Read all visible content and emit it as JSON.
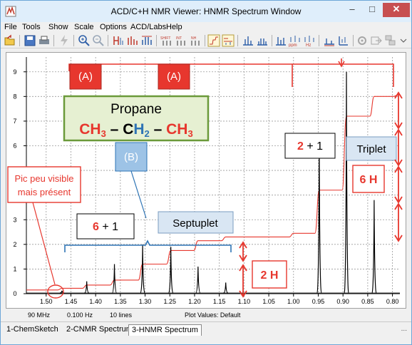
{
  "window": {
    "title": "ACD/C+H NMR Viewer: HNMR Spectrum Window",
    "minimize_glyph": "–",
    "maximize_glyph": "□",
    "close_glyph": "✕"
  },
  "menu": [
    "File",
    "Tools",
    "Show",
    "Scale",
    "Options",
    "ACD/Labs",
    "Help"
  ],
  "toolbar": {
    "icons": [
      "open-file-icon",
      "save-icon",
      "print-icon",
      "lightning-icon",
      "zoom-in-icon",
      "zoom-out-icon",
      "peak-pick-icon",
      "peak-list-icon",
      "multiplet-icon",
      "shift-label-icon",
      "integral-label-icon",
      "multiplicity-label-icon",
      "integration-toggle-icon",
      "spectrum-view-icon",
      "peaks-icon",
      "multiplet-view-icon",
      "simulate-icon",
      "ppm-icon",
      "hz-icon",
      "baseline-icon",
      "lock-icon",
      "settings-icon",
      "export-icon",
      "arrange-icon",
      "menu-more-icon"
    ],
    "ppm_label": "ppm",
    "hz_label": "Hz",
    "shift_label": "SHIFT",
    "int_label": "INT",
    "nh_label": "NH"
  },
  "status": {
    "frequency": "90 MHz",
    "step": "0.100 Hz",
    "lines": "10 lines",
    "plot_values": "Plot Values: Default"
  },
  "tabs": [
    "1-ChemSketch",
    "2-CNMR Spectrum",
    "3-HNMR Spectrum"
  ],
  "tab_more": "...",
  "annotations": {
    "label_a1": "(A)",
    "label_a2": "(A)",
    "label_b": "(B)",
    "molecule_name": "Propane",
    "formula": {
      "ch3_left": "CH",
      "ch3_left_sub": "3",
      "dash1": " – ",
      "c_mid": "C",
      "h_mid": "H",
      "h_mid_sub": "2",
      "dash2": " – ",
      "ch3_right": "CH",
      "ch3_right_sub": "3"
    },
    "pic_note_line1": "Pic peu visible",
    "pic_note_line2": "mais présent",
    "sept_count_red": "6",
    "sept_count_rest": " + 1",
    "septuplet": "Septuplet",
    "trip_count_red": "2",
    "trip_count_rest": " + 1",
    "triplet": "Triplet",
    "h6": "6 H",
    "h2": "2 H",
    "colors": {
      "red": "#e7372e",
      "green_border": "#6b9a3a",
      "green_fill": "#e6f0d2",
      "blue_label": "#2e74b5",
      "triplet_fill": "#d9e6f3"
    }
  },
  "chart_data": {
    "type": "line",
    "xlabel": "",
    "ylabel": "",
    "xlim": [
      1.54,
      0.785
    ],
    "ylim": [
      0,
      9.6
    ],
    "x_ticks": [
      1.5,
      1.45,
      1.4,
      1.35,
      1.3,
      1.25,
      1.2,
      1.15,
      1.1,
      1.05,
      1.0,
      0.95,
      0.9,
      0.85,
      0.8
    ],
    "x_tick_labels": [
      "1.50",
      "1.45",
      "1.40",
      "1.35",
      "1.30",
      "1.25",
      "1.20",
      "1.15",
      "1.10",
      "1.05",
      "1.00",
      "0.95",
      "0.90",
      "0.85",
      "0.80"
    ],
    "y_ticks": [
      0,
      1,
      2,
      3,
      4,
      5,
      6,
      7,
      8,
      9
    ],
    "y_tick_labels": [
      "0",
      "1",
      "2",
      "3",
      "4",
      "5",
      "6",
      "7",
      "8",
      "9"
    ],
    "grid": true,
    "series": [
      {
        "name": "",
        "kind": "spectrum",
        "color": "#000000",
        "peaks": [
          {
            "x": 1.468,
            "y": 0.12
          },
          {
            "x": 1.418,
            "y": 0.5
          },
          {
            "x": 1.362,
            "y": 1.2
          },
          {
            "x": 1.305,
            "y": 2.0
          },
          {
            "x": 1.248,
            "y": 1.9
          },
          {
            "x": 1.193,
            "y": 1.1
          },
          {
            "x": 1.137,
            "y": 0.45
          },
          {
            "x": 0.948,
            "y": 6.5
          },
          {
            "x": 0.893,
            "y": 9.0
          },
          {
            "x": 0.837,
            "y": 3.8
          }
        ]
      },
      {
        "name": "",
        "kind": "integral",
        "color": "#e7372e",
        "steps": [
          {
            "x": 1.54,
            "y": 0.15
          },
          {
            "x": 1.468,
            "y": 0.22
          },
          {
            "x": 1.418,
            "y": 0.35
          },
          {
            "x": 1.362,
            "y": 0.55
          },
          {
            "x": 1.305,
            "y": 1.2
          },
          {
            "x": 1.248,
            "y": 1.75
          },
          {
            "x": 1.193,
            "y": 2.15
          },
          {
            "x": 1.137,
            "y": 2.3
          },
          {
            "x": 1.0,
            "y": 2.45
          },
          {
            "x": 0.948,
            "y": 4.2
          },
          {
            "x": 0.893,
            "y": 7.2
          },
          {
            "x": 0.837,
            "y": 8.0
          },
          {
            "x": 0.79,
            "y": 8.05
          }
        ]
      }
    ]
  }
}
